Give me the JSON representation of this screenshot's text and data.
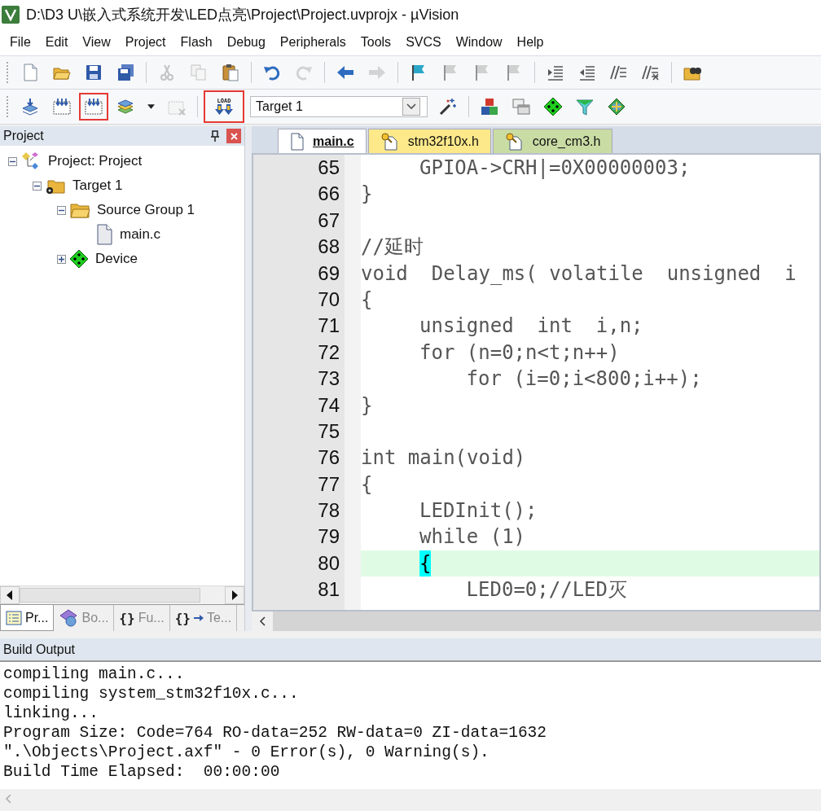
{
  "window": {
    "title": "D:\\D3 U\\嵌入式系统开发\\LED点亮\\Project\\Project.uvprojx - µVision"
  },
  "menu": [
    "File",
    "Edit",
    "View",
    "Project",
    "Flash",
    "Debug",
    "Peripherals",
    "Tools",
    "SVCS",
    "Window",
    "Help"
  ],
  "toolbars": [
    [
      {
        "kind": "new",
        "disabled": false,
        "highlighted": false
      },
      {
        "kind": "open",
        "disabled": false,
        "highlighted": false
      },
      {
        "kind": "save",
        "disabled": false,
        "highlighted": false
      },
      {
        "kind": "saveall",
        "disabled": false,
        "highlighted": false
      },
      {
        "kind": "separator"
      },
      {
        "kind": "cut",
        "disabled": true,
        "highlighted": false
      },
      {
        "kind": "copy",
        "disabled": true,
        "highlighted": false
      },
      {
        "kind": "paste",
        "disabled": false,
        "highlighted": false
      },
      {
        "kind": "separator"
      },
      {
        "kind": "undo",
        "disabled": false,
        "highlighted": false
      },
      {
        "kind": "redo",
        "disabled": true,
        "highlighted": false
      },
      {
        "kind": "separator"
      },
      {
        "kind": "back",
        "disabled": false,
        "highlighted": false
      },
      {
        "kind": "forward",
        "disabled": true,
        "highlighted": false
      },
      {
        "kind": "separator"
      },
      {
        "kind": "bookmark",
        "disabled": false,
        "highlighted": false
      },
      {
        "kind": "bookmark",
        "disabled": true,
        "highlighted": false
      },
      {
        "kind": "bookmark",
        "disabled": true,
        "highlighted": false
      },
      {
        "kind": "bookmark",
        "disabled": true,
        "highlighted": false
      },
      {
        "kind": "separator"
      },
      {
        "kind": "indent",
        "disabled": false,
        "highlighted": false
      },
      {
        "kind": "unindent",
        "disabled": false,
        "highlighted": false
      },
      {
        "kind": "comment",
        "disabled": false,
        "highlighted": false
      },
      {
        "kind": "uncomment",
        "disabled": false,
        "highlighted": false
      },
      {
        "kind": "separator"
      },
      {
        "kind": "find",
        "disabled": false,
        "highlighted": false
      }
    ],
    [
      {
        "kind": "translate",
        "disabled": false,
        "highlighted": false
      },
      {
        "kind": "build",
        "disabled": false,
        "highlighted": false
      },
      {
        "kind": "build",
        "disabled": false,
        "highlighted": true
      },
      {
        "kind": "batch",
        "disabled": false,
        "highlighted": false
      },
      {
        "kind": "dropdown",
        "disabled": false,
        "highlighted": false
      },
      {
        "kind": "stop",
        "disabled": true,
        "highlighted": false
      },
      {
        "kind": "separator"
      },
      {
        "kind": "load",
        "label": "LOAD",
        "disabled": false,
        "highlighted": true
      },
      {
        "kind": "select",
        "value": "Target 1"
      },
      {
        "kind": "wand",
        "disabled": false,
        "highlighted": false
      },
      {
        "kind": "separator"
      },
      {
        "kind": "blocks",
        "disabled": false,
        "highlighted": false
      },
      {
        "kind": "windows",
        "disabled": false,
        "highlighted": false
      },
      {
        "kind": "diamond",
        "disabled": false,
        "highlighted": false
      },
      {
        "kind": "funnel",
        "disabled": false,
        "highlighted": false
      },
      {
        "kind": "pack",
        "disabled": false,
        "highlighted": false
      }
    ]
  ],
  "project_panel": {
    "title": "Project",
    "tree": [
      {
        "kind": "project",
        "label": "Project: Project",
        "expanded": true,
        "children": [
          {
            "kind": "target",
            "label": "Target 1",
            "expanded": true,
            "children": [
              {
                "kind": "group",
                "label": "Source Group 1",
                "expanded": true,
                "children": [
                  {
                    "kind": "file",
                    "label": "main.c"
                  }
                ]
              },
              {
                "kind": "device",
                "label": "Device",
                "expanded": false
              }
            ]
          }
        ]
      }
    ],
    "tabs": [
      {
        "kind": "project",
        "label": "Pr...",
        "selected": true
      },
      {
        "kind": "books",
        "label": "Bo...",
        "selected": false
      },
      {
        "kind": "functions",
        "glyph": "{}",
        "label": "Fu...",
        "selected": false
      },
      {
        "kind": "templates",
        "glyph": "{}",
        "label": "Te...",
        "selected": false
      }
    ]
  },
  "editor": {
    "tabs": [
      {
        "kind": "source",
        "label": "main.c",
        "color": "#ffffff",
        "selected": true
      },
      {
        "kind": "header",
        "label": "stm32f10x.h",
        "color": "#fde98a",
        "selected": false
      },
      {
        "kind": "header",
        "label": "core_cm3.h",
        "color": "#c9dca4",
        "selected": false
      }
    ],
    "lines": [
      {
        "number": "65",
        "text": "     GPIOA->CRH|=0X00000003;",
        "current": false
      },
      {
        "number": "66",
        "text": "}",
        "current": false
      },
      {
        "number": "67",
        "current": false
      },
      {
        "number": "68",
        "text": "//延时",
        "current": false
      },
      {
        "number": "69",
        "text": "void  Delay_ms( volatile  unsigned  i",
        "current": false
      },
      {
        "number": "70",
        "text": "{",
        "current": false
      },
      {
        "number": "71",
        "text": "     unsigned  int  i,n;",
        "current": false
      },
      {
        "number": "72",
        "text": "     for (n=0;n<t;n++)",
        "current": false
      },
      {
        "number": "73",
        "text": "         for (i=0;i<800;i++);",
        "current": false
      },
      {
        "number": "74",
        "text": "}",
        "current": false
      },
      {
        "number": "75",
        "current": false
      },
      {
        "number": "76",
        "text": "int main(void)",
        "current": false
      },
      {
        "number": "77",
        "text": "{",
        "current": false
      },
      {
        "number": "78",
        "text": "     LEDInit();",
        "current": false
      },
      {
        "number": "79",
        "text": "     while (1)",
        "current": false
      },
      {
        "number": "80",
        "text": "     {",
        "current": true,
        "brace_match": true
      },
      {
        "number": "81",
        "text": "         LED0=0;//LED灭",
        "current": false
      }
    ]
  },
  "build_output": {
    "title": "Build Output",
    "lines": [
      "compiling main.c...",
      "compiling system_stm32f10x.c...",
      "linking...",
      "Program Size: Code=764 RO-data=252 RW-data=0 ZI-data=1632",
      "\".\\Objects\\Project.axf\" - 0 Error(s), 0 Warning(s).",
      "Build Time Elapsed:  00:00:00"
    ]
  }
}
